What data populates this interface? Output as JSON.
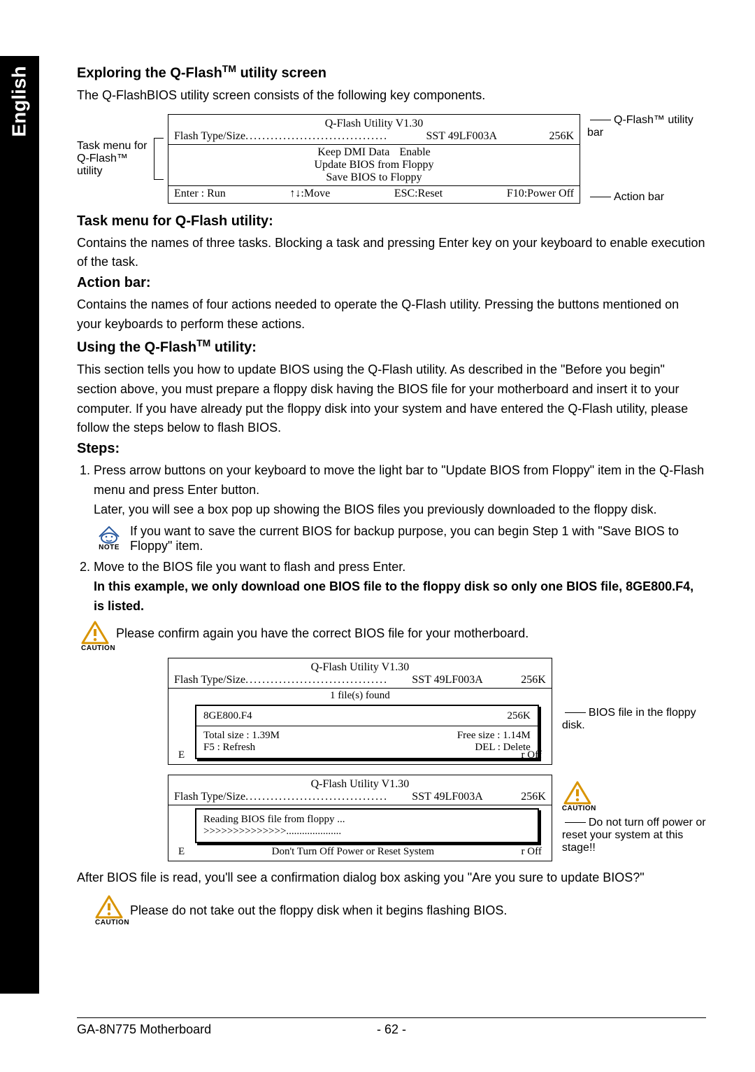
{
  "sideTab": "English",
  "headings": {
    "exploring": "Exploring the Q-Flash",
    "exploringSuffix": " utility screen",
    "taskMenu": "Task menu for Q-Flash utility:",
    "actionBar": "Action bar:",
    "usingQFlash": "Using the Q-Flash",
    "usingSuffix": " utility:",
    "steps": "Steps:"
  },
  "exploringText": "The Q-FlashBIOS utility screen consists of the following key components.",
  "screen1": {
    "title": "Q-Flash Utility V1.30",
    "flashLabel": "Flash Type/Size",
    "flashVal": "SST 49LF003A",
    "sizeVal": "256K",
    "menu": {
      "line1a": "Keep DMI Data",
      "line1b": "Enable",
      "line2": "Update BIOS from Floppy",
      "line3": "Save BIOS to Floppy"
    },
    "actions": {
      "enter": "Enter : Run",
      "move": "↑↓:Move",
      "esc": "ESC:Reset",
      "f10": "F10:Power Off"
    },
    "callouts": {
      "leftTop": "Task menu for",
      "leftBottom": "Q-Flash™ utility",
      "rightTop": "Q-Flash™ utility bar",
      "rightBottom": "Action bar"
    }
  },
  "taskMenuText": "Contains the names of three tasks. Blocking a task and pressing Enter key on your keyboard to enable execution of the task.",
  "actionBarText": "Contains the names of four actions needed to operate the Q-Flash utility. Pressing the buttons mentioned on your keyboards to perform these actions.",
  "usingText": "This section tells you how to update BIOS using the Q-Flash utility. As described in the \"Before you begin\" section above, you must prepare a floppy disk having the BIOS file for your motherboard and insert it to your computer. If you have already put the floppy disk into your system and have entered the Q-Flash utility, please follow the steps below to flash BIOS.",
  "step1a": "Press arrow buttons on your keyboard to move the light bar to \"Update BIOS from Floppy\" item in the Q-Flash menu and press Enter button.",
  "step1b": "Later, you will see a box pop up showing the BIOS files you previously downloaded to the floppy disk.",
  "noteText": "If you want to save the current BIOS for backup purpose, you can begin Step 1 with \"Save BIOS to Floppy\" item.",
  "step2a": "Move to the BIOS file you want to flash and press Enter.",
  "step2b": "In this example, we only download one BIOS file to the floppy disk so only one BIOS file, 8GE800.F4, is listed.",
  "caution1": "Please confirm again you have the correct BIOS file for your motherboard.",
  "screen2": {
    "title": "Q-Flash Utility V1.30",
    "flashLabel": "Flash Type/Size",
    "flashVal": "SST 49LF003A",
    "sizeVal": "256K",
    "filesFound": "1 file(s) found",
    "fileName": "8GE800.F4",
    "fileSize": "256K",
    "totalSize": "Total size : 1.39M",
    "freeSize": "Free size : 1.14M",
    "f5": "F5 : Refresh",
    "del": "DEL : Delete",
    "edgeL": "E",
    "edgeR": "r Off"
  },
  "callout2": "BIOS file in the floppy disk.",
  "screen3": {
    "title": "Q-Flash Utility V1.30",
    "flashLabel": "Flash Type/Size",
    "flashVal": "SST 49LF003A",
    "sizeVal": "256K",
    "reading": "Reading BIOS file from floppy ...",
    "progress": ">>>>>>>>>>>>>>.....................",
    "warning": "Don't Turn Off Power or Reset System",
    "edgeL": "E",
    "edgeR": "r Off"
  },
  "callout3": "Do not turn off power or reset your system at this stage!!",
  "afterRead": "After BIOS file is read, you'll see a confirmation dialog box asking you \"Are you sure to update BIOS?\"",
  "caution2": "Please do not take out the floppy disk when it begins flashing BIOS.",
  "footer": {
    "model": "GA-8N775 Motherboard",
    "page": "- 62 -"
  },
  "labels": {
    "note": "NOTE",
    "caution": "CAUTION",
    "tm": "TM"
  }
}
